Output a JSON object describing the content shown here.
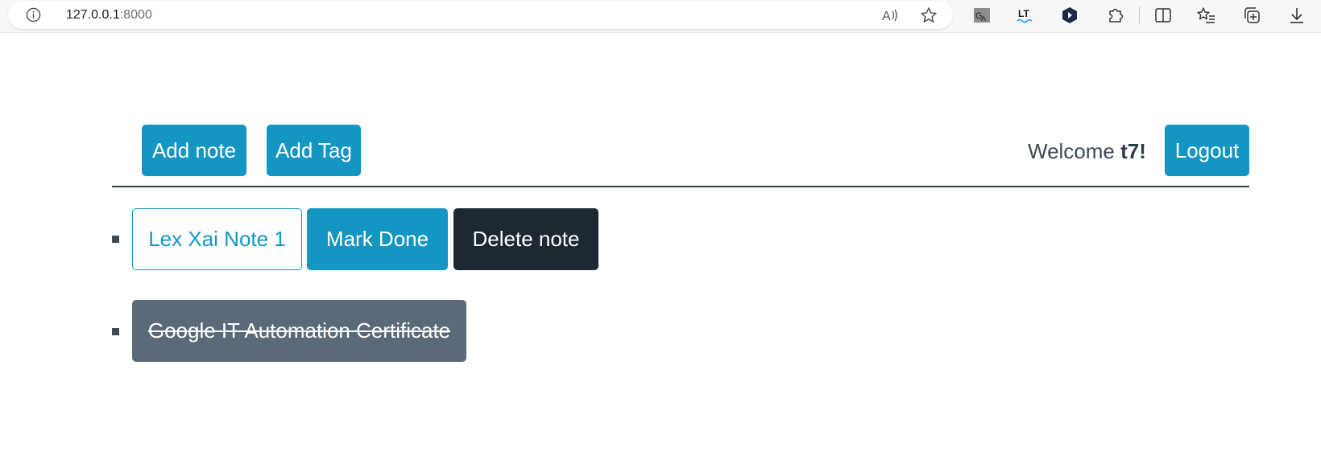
{
  "browser": {
    "url_host": "127.0.0.1",
    "url_port": ":8000",
    "icons": [
      "info-icon",
      "read-aloud-icon",
      "favorite-star-icon",
      "translate-extension-icon",
      "languagetool-extension-icon",
      "dark-extension-icon",
      "extensions-puzzle-icon",
      "split-screen-icon",
      "favorites-list-icon",
      "collections-icon",
      "downloads-icon"
    ]
  },
  "header": {
    "add_note_label": "Add note",
    "add_tag_label": "Add Tag",
    "welcome_prefix": "Welcome ",
    "username": "t7!",
    "logout_label": "Logout"
  },
  "notes": [
    {
      "title": "Lex Xai Note 1",
      "done": false,
      "mark_done_label": "Mark Done",
      "delete_label": "Delete note"
    },
    {
      "title": "Google IT Automation Certificate",
      "done": true
    }
  ],
  "colors": {
    "info": "#1496c3",
    "dark": "#1e2832",
    "secondary": "#5a6a78",
    "text": "#3c4a56"
  }
}
